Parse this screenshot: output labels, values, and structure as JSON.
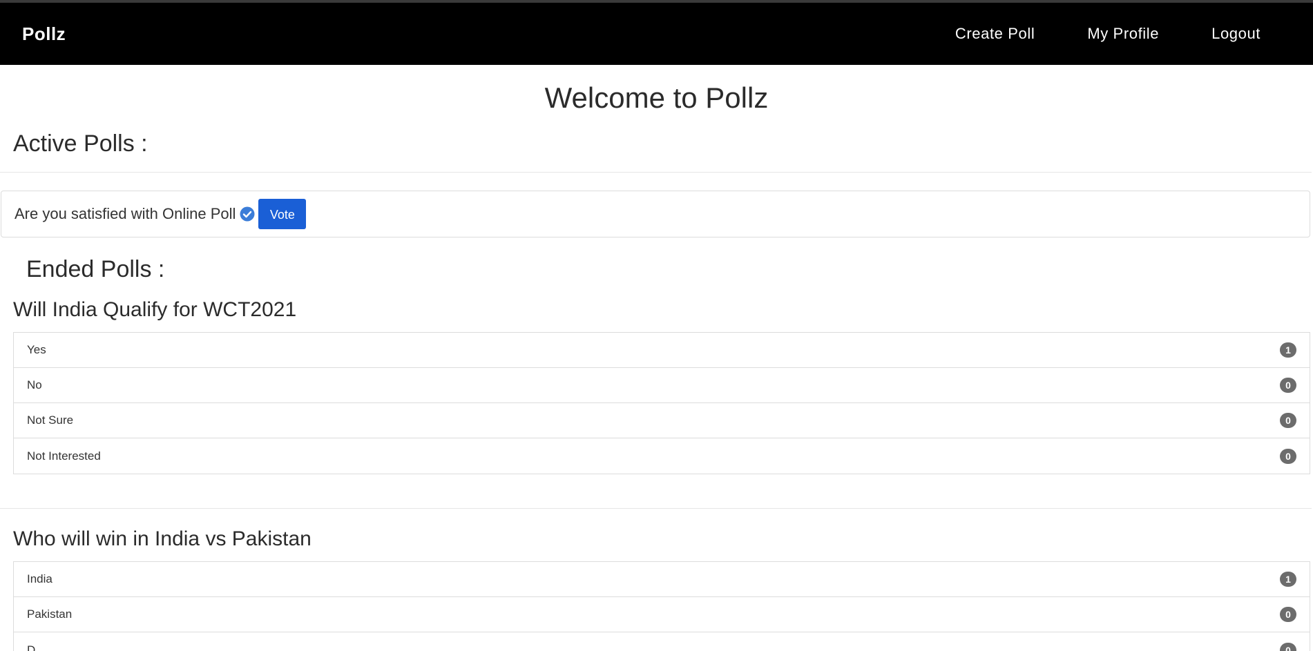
{
  "navbar": {
    "brand": "Pollz",
    "links": [
      "Create Poll",
      "My Profile",
      "Logout"
    ]
  },
  "main": {
    "welcome": "Welcome to Pollz",
    "active_title": "Active Polls :",
    "active_polls": [
      {
        "question": "Are you satisfied with Online Poll",
        "vote_label": "Vote"
      }
    ],
    "ended_title": "Ended Polls :",
    "ended_polls": [
      {
        "question": "Will India Qualify for WCT2021",
        "options": [
          {
            "label": "Yes",
            "count": "1"
          },
          {
            "label": "No",
            "count": "0"
          },
          {
            "label": "Not Sure",
            "count": "0"
          },
          {
            "label": "Not Interested",
            "count": "0"
          }
        ]
      },
      {
        "question": "Who will win in India vs Pakistan",
        "options": [
          {
            "label": "India",
            "count": "1"
          },
          {
            "label": "Pakistan",
            "count": "0"
          },
          {
            "label": "D...",
            "count": "0"
          }
        ]
      }
    ]
  },
  "colors": {
    "navbar_bg": "#000000",
    "vote_button": "#1a5fd6",
    "badge": "#6c6c6c",
    "check_icon": "#3b7dd8"
  },
  "icons": {
    "verified": "check-circle-icon"
  }
}
